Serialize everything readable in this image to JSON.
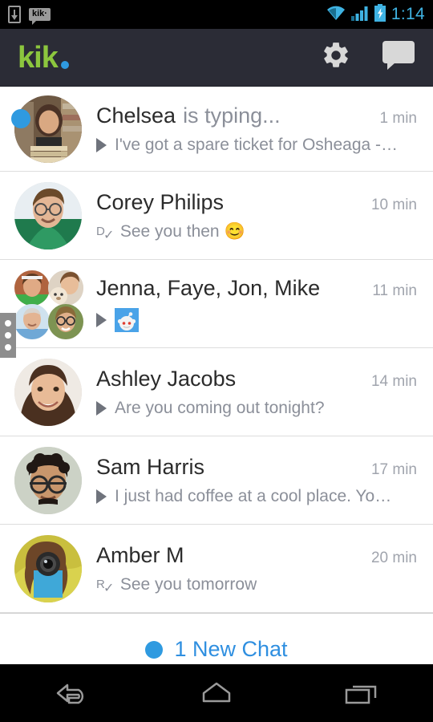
{
  "status_bar": {
    "download_icon": "download-icon",
    "app_notification_label": "kik·",
    "wifi_icon": "wifi-icon",
    "signal_icon": "cellular-signal-icon",
    "battery_icon": "battery-charging-icon",
    "time": "1:14"
  },
  "app_bar": {
    "logo_text": "kik",
    "logo_color": "#8cc63e",
    "logo_dot_color": "#2f9ae0",
    "settings_label": "Settings",
    "new_chat_label": "New Chat",
    "background": "#2b2c36"
  },
  "chats": [
    {
      "name": "Chelsea",
      "typing_text": "is typing...",
      "time": "1 min",
      "snippet": "I've got a spare ticket for Osheaga -…",
      "status": "play",
      "unread": true,
      "avatar_type": "single",
      "avatar_colors": [
        "#7d6a58",
        "#c9b49a"
      ]
    },
    {
      "name": "Corey Philips",
      "typing_text": "",
      "time": "10 min",
      "snippet": "See you then 😊",
      "status": "delivered",
      "status_letter": "D",
      "unread": false,
      "avatar_type": "single",
      "avatar_colors": [
        "#cfd8df",
        "#2f7d55"
      ]
    },
    {
      "name": "Jenna, Faye, Jon, Mike",
      "typing_text": "",
      "time": "11 min",
      "snippet": "",
      "status": "play",
      "has_thumbnail": true,
      "thumbnail_color": "#4aa3e8",
      "unread": false,
      "avatar_type": "group",
      "group_colors": [
        "#b8795f",
        "#d8b79a",
        "#9fc3dd",
        "#86a05c"
      ]
    },
    {
      "name": "Ashley Jacobs",
      "typing_text": "",
      "time": "14 min",
      "snippet": "Are you coming out tonight?",
      "status": "play",
      "unread": false,
      "avatar_type": "single",
      "avatar_colors": [
        "#e8c4ac",
        "#4a3226"
      ]
    },
    {
      "name": "Sam Harris",
      "typing_text": "",
      "time": "17 min",
      "snippet": "I just had coffee at a cool place. Yo…",
      "status": "play",
      "unread": false,
      "avatar_type": "single",
      "avatar_colors": [
        "#cdd4c8",
        "#3a2d26"
      ]
    },
    {
      "name": "Amber M",
      "typing_text": "",
      "time": "20 min",
      "snippet": "See you tomorrow",
      "status": "read",
      "status_letter": "R",
      "unread": false,
      "avatar_type": "single",
      "avatar_colors": [
        "#d6c24a",
        "#8a5a32"
      ]
    }
  ],
  "scroll_handle": {
    "name": "fast-scroll-handle",
    "dots": 3
  },
  "new_chat_banner": {
    "count_text": "1 New Chat",
    "dot_color": "#2f9ae0",
    "text_color": "#2f8fe0"
  },
  "nav_bar": {
    "back_label": "Back",
    "home_label": "Home",
    "recents_label": "Recent apps"
  }
}
